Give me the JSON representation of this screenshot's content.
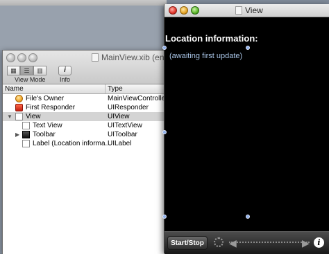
{
  "xib_window": {
    "title": "MainView.xib (en)",
    "toolbar": {
      "view_mode_label": "View Mode",
      "info_label": "Info",
      "info_glyph": "i"
    },
    "columns": {
      "name": "Name",
      "type": "Type"
    },
    "rows": [
      {
        "name": "File's Owner",
        "type": "MainViewController",
        "icon": "files-owner-icon"
      },
      {
        "name": "First Responder",
        "type": "UIResponder",
        "icon": "first-responder-icon"
      },
      {
        "name": "View",
        "type": "UIView",
        "icon": "view-icon",
        "expanded": true
      },
      {
        "name": "Text View",
        "type": "UITextView",
        "icon": "text-view-icon"
      },
      {
        "name": "Toolbar",
        "type": "UIToolbar",
        "icon": "toolbar-icon",
        "collapsed": true
      },
      {
        "name": "Label (Location informa...",
        "type": "UILabel",
        "icon": "label-icon"
      }
    ]
  },
  "view_window": {
    "title": "View",
    "location_header": "Location information:",
    "location_status": "(awaiting first update)",
    "toolbar": {
      "start_stop_label": "Start/Stop",
      "info_glyph": "i"
    }
  },
  "colors": {
    "view_background": "#000000",
    "status_text": "#a8c4e6",
    "selected_row": "#d4d4d4"
  }
}
